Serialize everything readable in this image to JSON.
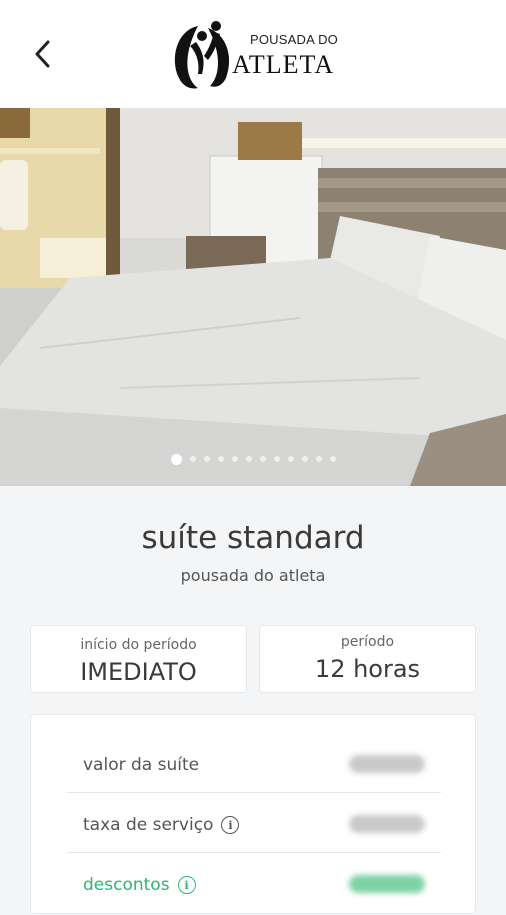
{
  "header": {
    "back_icon": "chevron-left-icon",
    "logo": {
      "line1": "POUSADA DO",
      "line2": "ATLETA"
    }
  },
  "gallery": {
    "image_count": 12,
    "active_index": 0
  },
  "suite": {
    "title": "suíte standard",
    "subtitle": "pousada do atleta"
  },
  "period_start": {
    "label": "início do período",
    "value": "IMEDIATO"
  },
  "period": {
    "label": "período",
    "value": "12 horas"
  },
  "pricing": {
    "rows": [
      {
        "name": "valor da suíte",
        "info": false
      },
      {
        "name": "taxa de serviço",
        "info": true
      },
      {
        "name": "descontos",
        "info": true
      }
    ]
  },
  "colors": {
    "accent_green": "#2bb673",
    "background": "#f4f5f7"
  }
}
